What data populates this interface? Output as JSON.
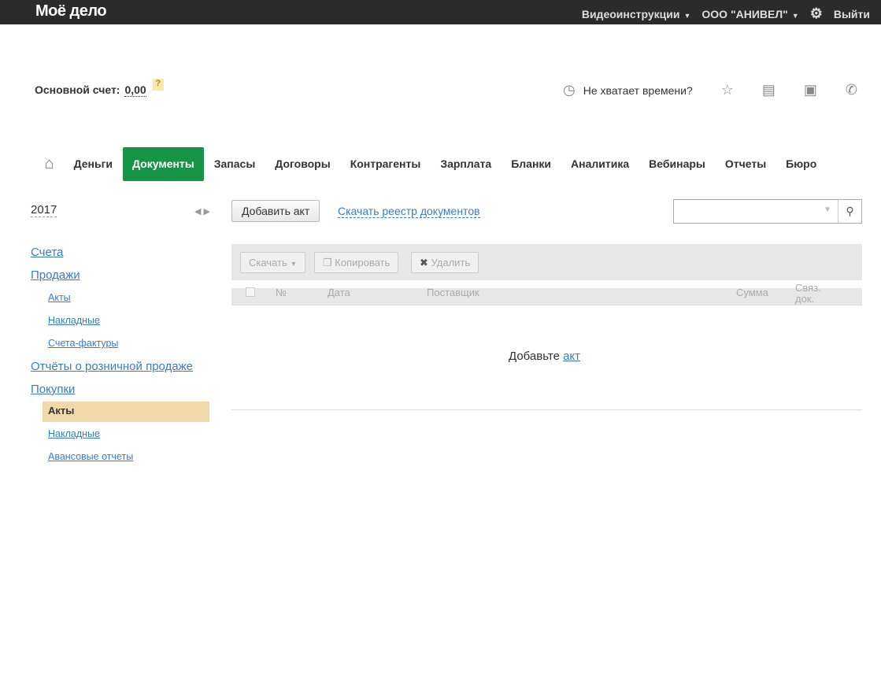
{
  "header": {
    "logo": "Моё дело",
    "video": "Видеоинструкции",
    "org": "ООО \"АНИВЕЛ\"",
    "logout": "Выйти"
  },
  "account": {
    "label": "Основной счет:",
    "value": "0,00",
    "help": "?"
  },
  "tools": {
    "time": "Не хватает времени?"
  },
  "nav": [
    "Деньги",
    "Документы",
    "Запасы",
    "Договоры",
    "Контрагенты",
    "Зарплата",
    "Бланки",
    "Аналитика",
    "Вебинары",
    "Отчеты",
    "Бюро"
  ],
  "sidebar": {
    "year": "2017",
    "items": [
      "Счета",
      "Продажи",
      "Акты",
      "Накладные",
      "Счета-фактуры",
      "Отчёты о розничной продаже",
      "Покупки",
      "Акты",
      "Накладные",
      "Авансовые отчеты"
    ]
  },
  "main": {
    "add": "Добавить акт",
    "registry": "Скачать реестр документов",
    "download": "Скачать",
    "copy": "Копировать",
    "delete": "Удалить",
    "columns": [
      "№",
      "Дата",
      "Поставщик",
      "Сумма",
      "Связ.",
      "док."
    ],
    "empty": "Добавьте",
    "empty_link": "акт"
  }
}
